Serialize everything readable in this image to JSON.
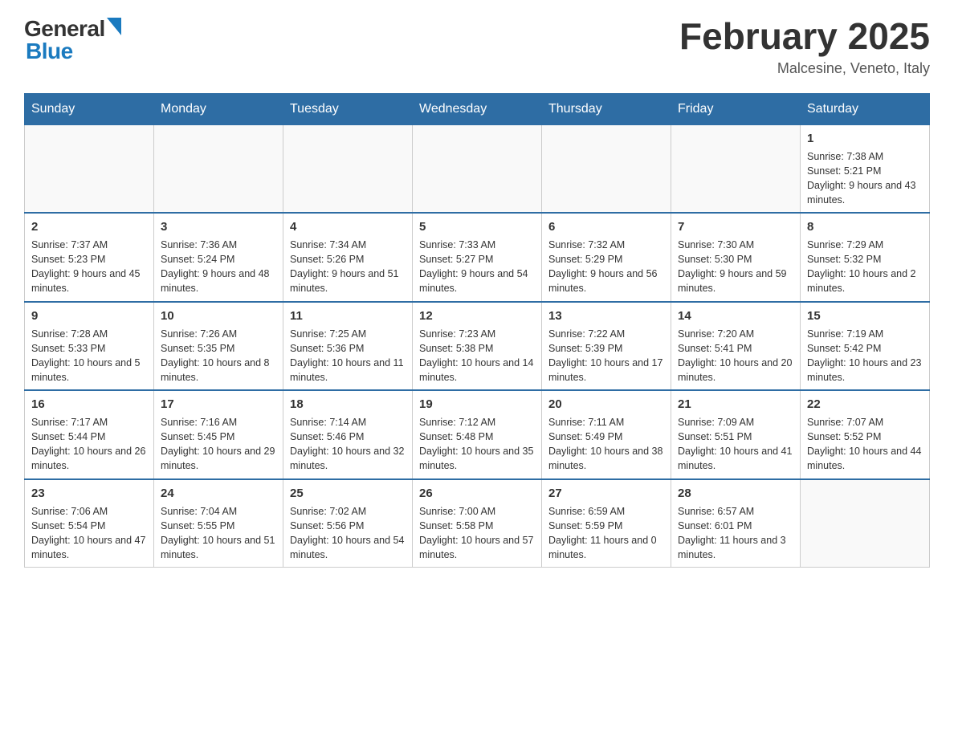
{
  "header": {
    "logo_general": "General",
    "logo_blue": "Blue",
    "title": "February 2025",
    "subtitle": "Malcesine, Veneto, Italy"
  },
  "calendar": {
    "weekdays": [
      "Sunday",
      "Monday",
      "Tuesday",
      "Wednesday",
      "Thursday",
      "Friday",
      "Saturday"
    ],
    "weeks": [
      [
        {
          "day": "",
          "info": ""
        },
        {
          "day": "",
          "info": ""
        },
        {
          "day": "",
          "info": ""
        },
        {
          "day": "",
          "info": ""
        },
        {
          "day": "",
          "info": ""
        },
        {
          "day": "",
          "info": ""
        },
        {
          "day": "1",
          "info": "Sunrise: 7:38 AM\nSunset: 5:21 PM\nDaylight: 9 hours and 43 minutes."
        }
      ],
      [
        {
          "day": "2",
          "info": "Sunrise: 7:37 AM\nSunset: 5:23 PM\nDaylight: 9 hours and 45 minutes."
        },
        {
          "day": "3",
          "info": "Sunrise: 7:36 AM\nSunset: 5:24 PM\nDaylight: 9 hours and 48 minutes."
        },
        {
          "day": "4",
          "info": "Sunrise: 7:34 AM\nSunset: 5:26 PM\nDaylight: 9 hours and 51 minutes."
        },
        {
          "day": "5",
          "info": "Sunrise: 7:33 AM\nSunset: 5:27 PM\nDaylight: 9 hours and 54 minutes."
        },
        {
          "day": "6",
          "info": "Sunrise: 7:32 AM\nSunset: 5:29 PM\nDaylight: 9 hours and 56 minutes."
        },
        {
          "day": "7",
          "info": "Sunrise: 7:30 AM\nSunset: 5:30 PM\nDaylight: 9 hours and 59 minutes."
        },
        {
          "day": "8",
          "info": "Sunrise: 7:29 AM\nSunset: 5:32 PM\nDaylight: 10 hours and 2 minutes."
        }
      ],
      [
        {
          "day": "9",
          "info": "Sunrise: 7:28 AM\nSunset: 5:33 PM\nDaylight: 10 hours and 5 minutes."
        },
        {
          "day": "10",
          "info": "Sunrise: 7:26 AM\nSunset: 5:35 PM\nDaylight: 10 hours and 8 minutes."
        },
        {
          "day": "11",
          "info": "Sunrise: 7:25 AM\nSunset: 5:36 PM\nDaylight: 10 hours and 11 minutes."
        },
        {
          "day": "12",
          "info": "Sunrise: 7:23 AM\nSunset: 5:38 PM\nDaylight: 10 hours and 14 minutes."
        },
        {
          "day": "13",
          "info": "Sunrise: 7:22 AM\nSunset: 5:39 PM\nDaylight: 10 hours and 17 minutes."
        },
        {
          "day": "14",
          "info": "Sunrise: 7:20 AM\nSunset: 5:41 PM\nDaylight: 10 hours and 20 minutes."
        },
        {
          "day": "15",
          "info": "Sunrise: 7:19 AM\nSunset: 5:42 PM\nDaylight: 10 hours and 23 minutes."
        }
      ],
      [
        {
          "day": "16",
          "info": "Sunrise: 7:17 AM\nSunset: 5:44 PM\nDaylight: 10 hours and 26 minutes."
        },
        {
          "day": "17",
          "info": "Sunrise: 7:16 AM\nSunset: 5:45 PM\nDaylight: 10 hours and 29 minutes."
        },
        {
          "day": "18",
          "info": "Sunrise: 7:14 AM\nSunset: 5:46 PM\nDaylight: 10 hours and 32 minutes."
        },
        {
          "day": "19",
          "info": "Sunrise: 7:12 AM\nSunset: 5:48 PM\nDaylight: 10 hours and 35 minutes."
        },
        {
          "day": "20",
          "info": "Sunrise: 7:11 AM\nSunset: 5:49 PM\nDaylight: 10 hours and 38 minutes."
        },
        {
          "day": "21",
          "info": "Sunrise: 7:09 AM\nSunset: 5:51 PM\nDaylight: 10 hours and 41 minutes."
        },
        {
          "day": "22",
          "info": "Sunrise: 7:07 AM\nSunset: 5:52 PM\nDaylight: 10 hours and 44 minutes."
        }
      ],
      [
        {
          "day": "23",
          "info": "Sunrise: 7:06 AM\nSunset: 5:54 PM\nDaylight: 10 hours and 47 minutes."
        },
        {
          "day": "24",
          "info": "Sunrise: 7:04 AM\nSunset: 5:55 PM\nDaylight: 10 hours and 51 minutes."
        },
        {
          "day": "25",
          "info": "Sunrise: 7:02 AM\nSunset: 5:56 PM\nDaylight: 10 hours and 54 minutes."
        },
        {
          "day": "26",
          "info": "Sunrise: 7:00 AM\nSunset: 5:58 PM\nDaylight: 10 hours and 57 minutes."
        },
        {
          "day": "27",
          "info": "Sunrise: 6:59 AM\nSunset: 5:59 PM\nDaylight: 11 hours and 0 minutes."
        },
        {
          "day": "28",
          "info": "Sunrise: 6:57 AM\nSunset: 6:01 PM\nDaylight: 11 hours and 3 minutes."
        },
        {
          "day": "",
          "info": ""
        }
      ]
    ]
  }
}
